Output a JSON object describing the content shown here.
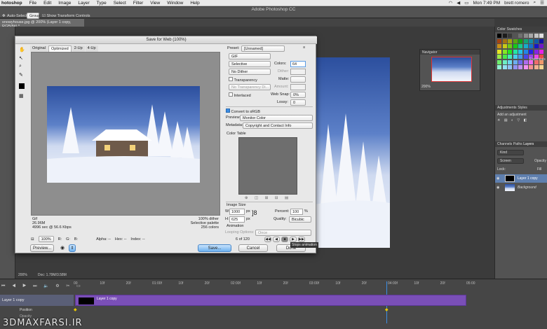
{
  "menubar": {
    "app": "hotoshop",
    "items": [
      "File",
      "Edit",
      "Image",
      "Layer",
      "Type",
      "Select",
      "Filter",
      "View",
      "Window",
      "Help"
    ],
    "clock": "Mon 7:49 PM",
    "user": "brett romero"
  },
  "app_title": "Adobe Photoshop CC",
  "options": {
    "auto_select": "Auto-Select:",
    "group": "Group",
    "show_transform": "Show Transform Controls"
  },
  "doc_tab": "snowyhouse.jpg @ 200% (Layer 1 copy, RGB/8#) *",
  "dialog": {
    "title": "Save for Web (100%)",
    "view_tabs": [
      "Original",
      "Optimized",
      "2-Up",
      "4-Up"
    ],
    "info_left": [
      "Gif",
      "26.96M",
      "4996 sec @ 56.6 Kbps"
    ],
    "info_right": [
      "100% dither",
      "Selective palette",
      "256 colors"
    ],
    "zoom": "100%",
    "readout": {
      "r": "R:",
      "g": "G:",
      "b": "B:",
      "alpha": "Alpha: --",
      "hex": "Hex: --",
      "index": "Index: --"
    },
    "preview_btn": "Preview...",
    "save_btn": "Save...",
    "cancel_btn": "Cancel",
    "done_btn": "Done",
    "preset_label": "Preset:",
    "preset_value": "[Unnamed]",
    "format": "GIF",
    "reduction": "Selective",
    "dither": "No Dither",
    "colors_label": "Colors:",
    "colors_value": "64",
    "dither_label": "Dither:",
    "transparency": "Transparency",
    "matte_label": "Matte:",
    "no_transp_dither": "No Transparency Di...",
    "amount_label": "Amount:",
    "interlaced": "Interlaced",
    "web_snap_label": "Web Snap:",
    "web_snap_value": "0%",
    "lossy_label": "Lossy:",
    "lossy_value": "0",
    "convert_srgb": "Convert to sRGB",
    "preview_label": "Preview:",
    "preview_value": "Monitor Color",
    "metadata_label": "Metadata:",
    "metadata_value": "Copyright and Contact Info",
    "color_table": "Color Table",
    "image_size": "Image Size",
    "w_label": "W:",
    "w_value": "1000",
    "h_label": "H:",
    "h_value": "625",
    "px": "px",
    "percent_label": "Percent:",
    "percent_value": "100",
    "pct": "%",
    "quality_label": "Quality:",
    "quality_value": "Bicubic",
    "animation": "Animation",
    "looping_label": "Looping Options:",
    "looping_value": "Once",
    "frame_counter": "6 of 120",
    "tooltip": "Stops animation"
  },
  "navigator": {
    "title": "Navigator",
    "zoom": "200%"
  },
  "right_panel": {
    "tabs1": [
      "Color",
      "Swatches"
    ],
    "tabs2": [
      "Adjustments",
      "Styles"
    ],
    "add_adjustment": "Add an adjustment",
    "tabs3": [
      "Channels",
      "Paths",
      "Layers"
    ],
    "kind": "Kind",
    "blend": "Screen",
    "opacity": "Opacity",
    "lock": "Lock:",
    "fill": "Fill",
    "layers": [
      "Layer 1 copy",
      "Background"
    ],
    "essentials": "Essentials"
  },
  "status": {
    "zoom": "200%",
    "doc": "Doc: 1.79M/3.58M"
  },
  "timeline": {
    "ruler": [
      "00",
      "10f",
      "20f",
      "01:00f",
      "10f",
      "20f",
      "02:00f",
      "10f",
      "20f",
      "03:00f",
      "10f",
      "20f",
      "04:00f",
      "10f",
      "20f",
      "05:00"
    ],
    "layer": "Layer 1 copy",
    "clip_label": "Layer 1 copy",
    "position": "Position",
    "opacity": "Opacity"
  },
  "watermark": "3DMAXFARSI.IR",
  "colors": {
    "accent": "#3b8de3",
    "clip": "#7a4fb7",
    "panel": "#535353"
  }
}
